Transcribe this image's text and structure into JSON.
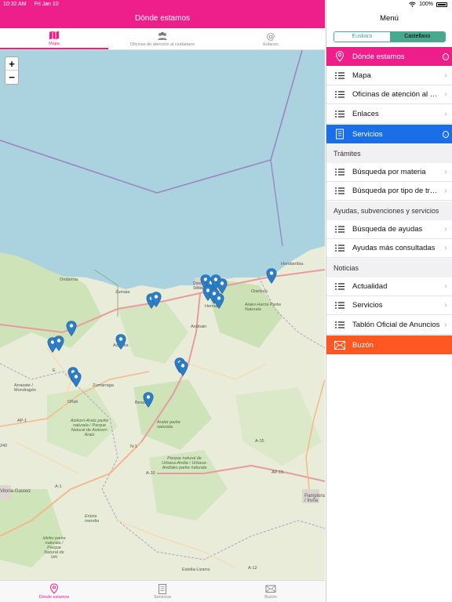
{
  "status": {
    "time": "10:32 AM",
    "date": "Fri Jan 10",
    "battery": "100%"
  },
  "nav": {
    "title": "Dónde estamos"
  },
  "top_tabs": [
    {
      "label": "Mapa",
      "icon": "map-icon"
    },
    {
      "label": "Oficinas de atención al ciudadano",
      "icon": "people-icon"
    },
    {
      "label": "Enlaces",
      "icon": "at-icon"
    }
  ],
  "map": {
    "zoom_in": "+",
    "zoom_out": "−",
    "labels": {
      "ondarroa": "Ondarroa",
      "zumaia": "Zumaia",
      "donostia": "Donostia / San Sebastián",
      "oiartzun": "Oiartzun",
      "hondarribia": "Hondarribia",
      "hernani": "Hernani",
      "andoain": "Andoain",
      "azpeitia": "Azpeitia",
      "aiako": "Aiako Harria Parke Naturala",
      "arrasate": "Arrasate / Mondragón",
      "onati": "Oñati",
      "zumarraga": "Zumarraga",
      "beasain": "Beasain",
      "aralar": "Aralar parke naturala",
      "aizkorri": "Aizkorri-Aratz parke naturala / Parque Natural de Aizkorri-Aratz",
      "urbasa": "Parque natural de Urbasa-Andia / Urbasa-Andiako parke naturala",
      "pamplona": "Pamplona / Iruña",
      "estella": "Estella-Lizarra",
      "entzia": "Entzia mendia",
      "izki": "Izkiko parke naturala / Parque Natural de Izki",
      "vitoria": "Vitoria-Gasteiz",
      "road_ap1": "AP-1",
      "road_a1": "A-1",
      "road_a10": "A-10",
      "road_a15": "A-15",
      "road_ap15": "AP-15",
      "road_a12": "A-12",
      "road_n1": "N-1",
      "road_240": "240",
      "road_e": "E"
    }
  },
  "bottom_tabs": [
    {
      "label": "Dónde estamos",
      "icon": "location-pin-icon"
    },
    {
      "label": "Servicios",
      "icon": "clipboard-icon"
    },
    {
      "label": "Buzón",
      "icon": "envelope-icon"
    }
  ],
  "menu": {
    "title": "Menú",
    "lang_euskara": "Euskara",
    "lang_castellano": "Castellano",
    "donde": "Dónde estamos",
    "mapa": "Mapa",
    "oficinas": "Oficinas de atención al ciudadano",
    "enlaces": "Enlaces",
    "servicios": "Servicios",
    "tramites": "Trámites",
    "busq_materia": "Búsqueda por materia",
    "busq_tipo": "Búsqueda por tipo de trámite",
    "ayudas_section": "Ayudas, subvenciones y servicios",
    "busq_ayudas": "Búsqueda de ayudas",
    "ayudas_consultadas": "Ayudas más consultadas",
    "noticias": "Noticias",
    "actualidad": "Actualidad",
    "servicios_news": "Servicios",
    "tablon": "Tablón Oficial de Anuncios",
    "buzon": "Buzón"
  },
  "colors": {
    "accent": "#ee1f8a",
    "selected": "#1a6fe8",
    "mailbox": "#ff5722",
    "lang": "#4aa88f",
    "sea": "#aad3df",
    "pin": "#2c7ec7"
  }
}
